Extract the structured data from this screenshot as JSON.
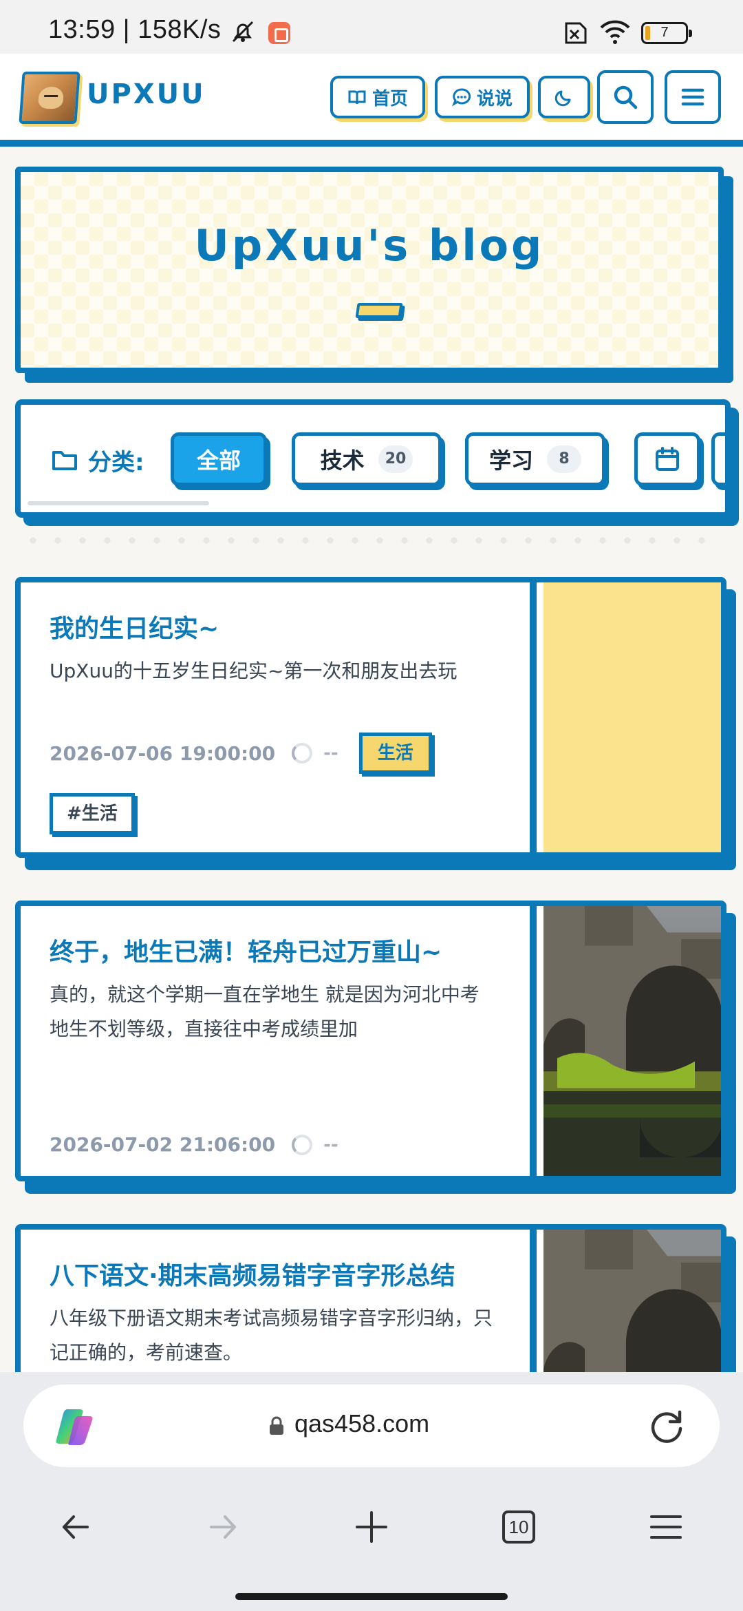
{
  "status_bar": {
    "time": "13:59 | 158K/s",
    "battery": "7"
  },
  "header": {
    "logo_text": "UPXUU",
    "nav": {
      "home_label": "首页",
      "talk_label": "说说"
    },
    "icons": [
      "book-icon",
      "chat-icon",
      "moon-icon",
      "search-icon",
      "menu-icon"
    ],
    "accent_color": "#0b78b8",
    "highlight_color": "#f5d76e"
  },
  "hero": {
    "title": "UpXuu's blog"
  },
  "categories": {
    "label": "分类:",
    "items": [
      {
        "name": "全部",
        "active": true
      },
      {
        "name": "技术",
        "count": "20"
      },
      {
        "name": "学习",
        "count": "8"
      }
    ],
    "extra_icon": "calendar-icon"
  },
  "posts": [
    {
      "title": "我的生日纪实~",
      "excerpt": "UpXuu的十五岁生日纪实~第一次和朋友出去玩",
      "date": "2026-07-06 19:00:00",
      "views": "--",
      "category": "生活",
      "tag": "#生活",
      "thumbnail": "yellow-placeholder"
    },
    {
      "title": "终于，地生已满！轻舟已过万重山~",
      "excerpt": "真的，就这个学期一直在学地生 就是因为河北中考地生不划等级，直接往中考成绩里加",
      "date": "2026-07-02 21:06:00",
      "views": "--",
      "thumbnail": "stone-bridge-photo"
    },
    {
      "title": "八下语文·期末高频易错字音字形总结",
      "excerpt": "八年级下册语文期末考试高频易错字音字形归纳，只记正确的，考前速查。",
      "thumbnail": "stone-bridge-photo"
    }
  ],
  "browser": {
    "url": "qas458.com",
    "tab_count": "10"
  }
}
